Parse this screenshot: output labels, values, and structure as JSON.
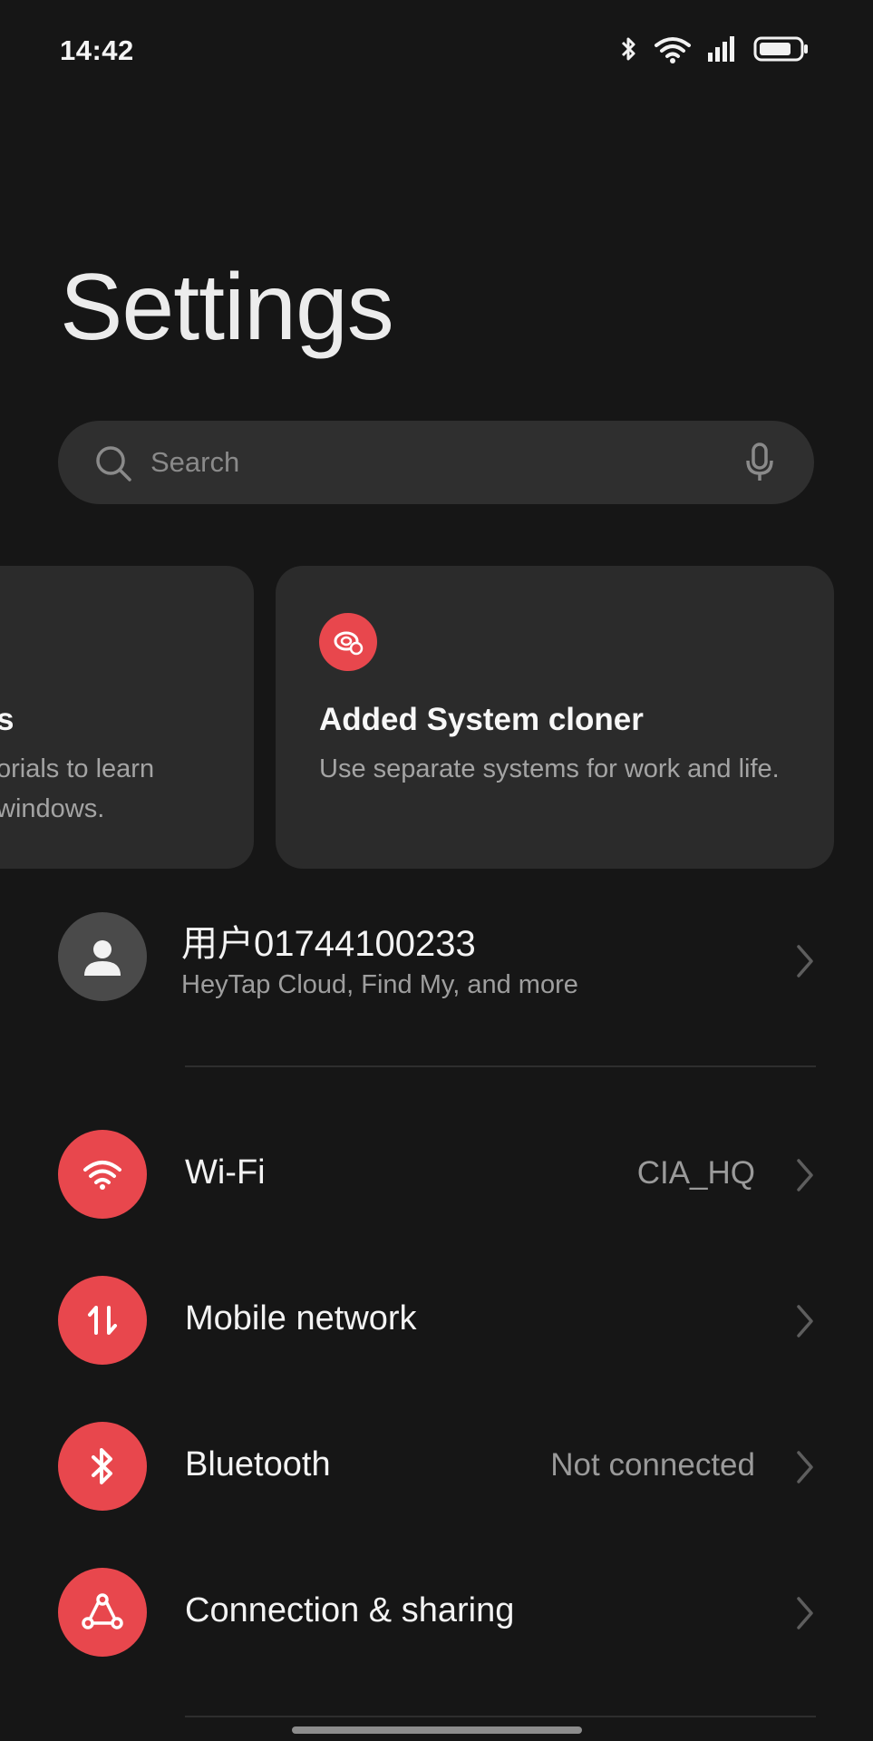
{
  "status_bar": {
    "time": "14:42"
  },
  "page": {
    "title": "Settings"
  },
  "search": {
    "placeholder": "Search"
  },
  "cards": [
    {
      "title": "s",
      "description": "orials to learn windows."
    },
    {
      "title": "Added System cloner",
      "description": "Use separate systems for work and life.",
      "icon": "system-cloner-icon"
    }
  ],
  "account": {
    "name": "用户01744100233",
    "subtitle": "HeyTap Cloud, Find My, and more"
  },
  "settings": [
    {
      "label": "Wi-Fi",
      "value": "CIA_HQ",
      "icon": "wifi-icon"
    },
    {
      "label": "Mobile network",
      "value": "",
      "icon": "mobile-data-icon"
    },
    {
      "label": "Bluetooth",
      "value": "Not connected",
      "icon": "bluetooth-icon"
    },
    {
      "label": "Connection & sharing",
      "value": "",
      "icon": "connection-sharing-icon"
    }
  ],
  "colors": {
    "accent": "#e8474d",
    "background": "#161616",
    "card": "#2b2b2b"
  }
}
